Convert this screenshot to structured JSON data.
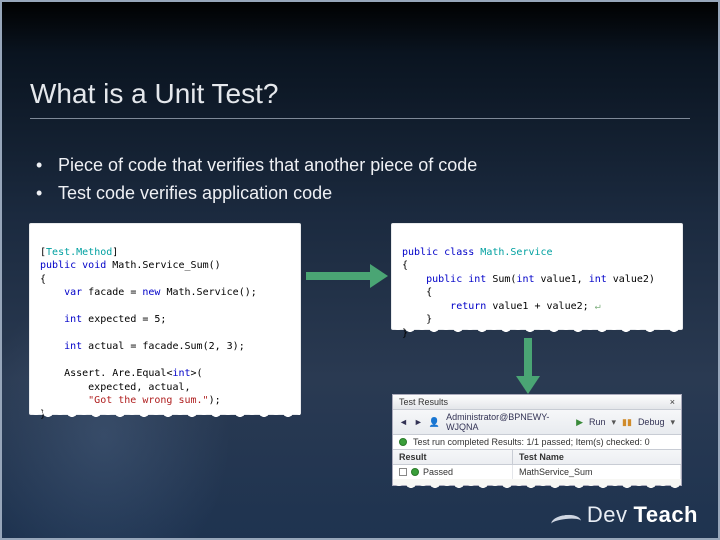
{
  "slide": {
    "title": "What is a Unit Test?",
    "bullets": [
      "Piece of code that verifies that another piece of code",
      "Test code verifies application code"
    ]
  },
  "code_left": {
    "attr_open": "[",
    "attr_name": "Test.Method",
    "attr_close": "]",
    "line_public": "public",
    "line_void": "void",
    "method_name": "Math.Service_Sum()",
    "brace_open": "{",
    "var_kw": "var",
    "facade_line": " facade = ",
    "new_kw": "new",
    "facade_ctor": " Math.Service();",
    "int_kw1": "int",
    "expected_line": " expected = 5;",
    "int_kw2": "int",
    "actual_line": " actual = facade.Sum(2, 3);",
    "assert": "Assert. Are.Equal<",
    "assert_type": "int",
    "assert_close": ">(",
    "arg1": "        expected, actual,",
    "arg_msg": "        \"Got the wrong sum.\"",
    "arg_end": ");",
    "brace_close": "}"
  },
  "code_right": {
    "kw_public": "public",
    "kw_class": "class",
    "class_name": "Math.Service",
    "brace_open": "{",
    "kw_public2": "public",
    "kw_int": "int",
    "method_sig": "Sum(",
    "kw_int_p1": "int",
    "p1": " value1, ",
    "kw_int_p2": "int",
    "p2": " value2)",
    "inner_open": "    {",
    "kw_return": "return",
    "return_body": " value1 + value2;",
    "inner_close": "    }",
    "brace_close": "}"
  },
  "test_results": {
    "title": "Test Results",
    "toolbar": {
      "user_host": "Administrator@BPNEWY-WJQNA",
      "run_label": "Run",
      "debug_label": "Debug"
    },
    "summary": "Test run completed Results: 1/1 passed; Item(s) checked: 0",
    "columns": {
      "result": "Result",
      "test_name": "Test Name"
    },
    "row": {
      "result": "Passed",
      "test_name": "MathService_Sum"
    }
  },
  "brand": {
    "dev": "Dev",
    "teach": "Teach"
  }
}
